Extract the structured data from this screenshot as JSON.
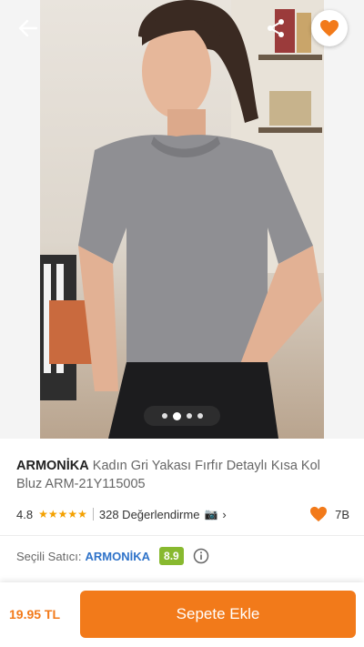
{
  "gallery": {
    "image_alt": "Woman wearing grey ruffle-collar short sleeve blouse",
    "dot_count": 4,
    "active_dot": 1
  },
  "header": {
    "back_icon": "back-arrow-icon",
    "share_icon": "share-icon",
    "favorite_icon": "heart-icon",
    "favorited": true
  },
  "product": {
    "brand": "ARMONİKA",
    "title": "Kadın Gri Yakası Fırfır Detaylı Kısa Kol Bluz ARM-21Y115005",
    "rating": "4.8",
    "stars": "★★★★★",
    "review_count": "328 Değerlendirme",
    "camera_icon": "📷",
    "likes": "7B"
  },
  "seller": {
    "label": "Seçili Satıcı:",
    "name": "ARMONİKA",
    "score": "8.9"
  },
  "bottom_bar": {
    "price": "19.95 TL",
    "cart_label": "Sepete Ekle"
  },
  "colors": {
    "accent": "#f27a1a",
    "seller_link": "#2f73c9",
    "score_badge": "#88b92f",
    "star": "#f4a100"
  }
}
